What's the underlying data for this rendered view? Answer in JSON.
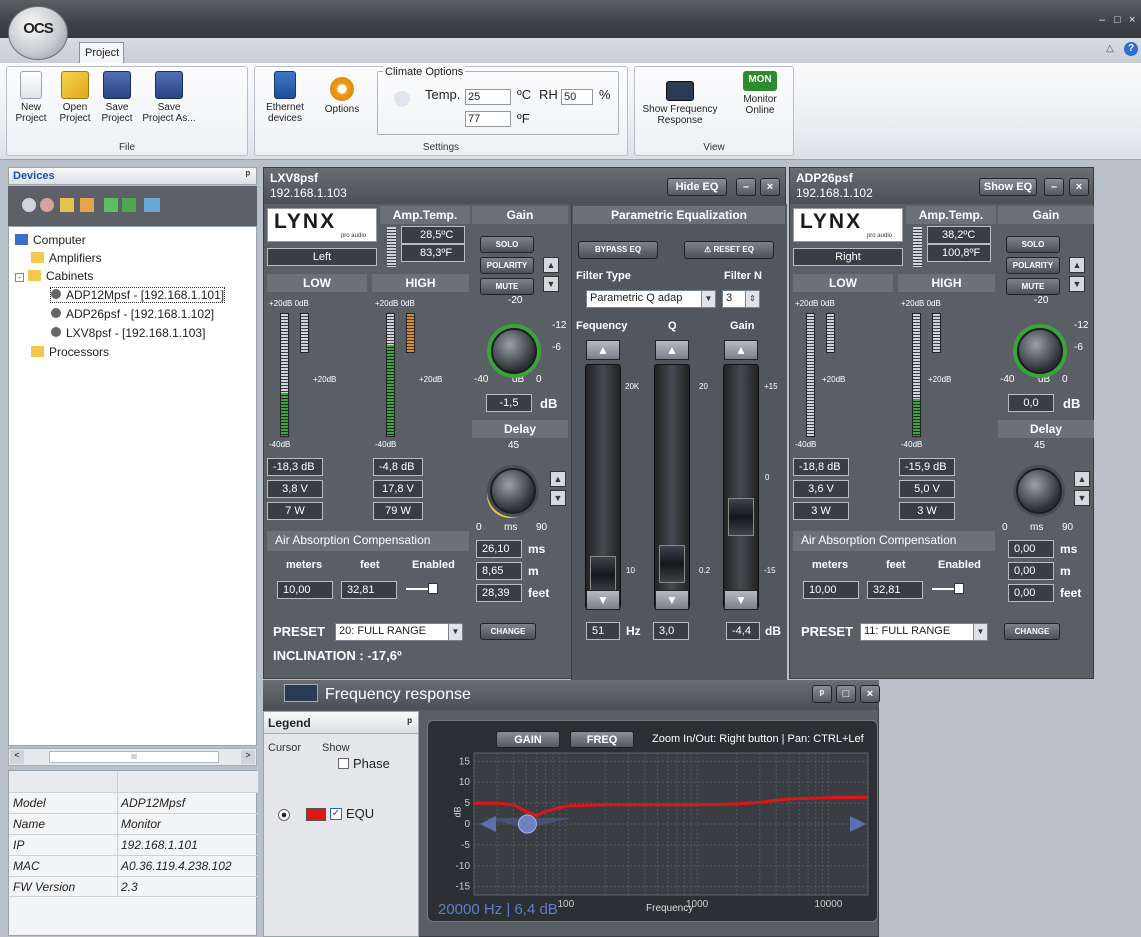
{
  "app": {
    "logo_text": "OCS",
    "tab": "Project"
  },
  "window_controls": {
    "min": "–",
    "max": "□",
    "close": "×",
    "collapse": "△",
    "help": "?"
  },
  "ribbon": {
    "file": {
      "title": "File",
      "new": "New\nProject",
      "open": "Open\nProject",
      "save": "Save\nProject",
      "save_as": "Save\nProject As..."
    },
    "settings": {
      "title": "Settings",
      "ethernet": "Ethernet\ndevices",
      "options": "Options",
      "climate_title": "Climate Options",
      "temp_label": "Temp.",
      "temp_c": "25",
      "unit_c": "ºC",
      "rh_label": "RH",
      "rh": "50",
      "unit_pct": "%",
      "temp_f": "77",
      "unit_f": "ºF"
    },
    "view": {
      "title": "View",
      "freq": "Show Frequency\nResponse",
      "monitor": "Monitor\nOnline",
      "mon_badge": "MON"
    }
  },
  "devices_panel": {
    "title": "Devices",
    "pin": "ᵖ",
    "tree": {
      "computer": "Computer",
      "amplifiers": "Amplifiers",
      "cabinets": "Cabinets",
      "cab1": "ADP12Mpsf - [192.168.1.101]",
      "cab2": "ADP26psf - [192.168.1.102]",
      "cab3": "LXV8psf - [192.168.1.103]",
      "processors": "Processors"
    },
    "scroll_mid": "III",
    "props": [
      {
        "k": "Model",
        "v": "ADP12Mpsf"
      },
      {
        "k": "Name",
        "v": "Monitor"
      },
      {
        "k": "IP",
        "v": "192.168.1.101"
      },
      {
        "k": "MAC",
        "v": "A0.36.119.4.238.102"
      },
      {
        "k": "FW Version",
        "v": "2.3"
      }
    ]
  },
  "dev1": {
    "name": "LXV8psf",
    "ip": "192.168.1.103",
    "eq_btn": "Hide EQ",
    "brand": "LYNX",
    "brand_sub": "pro audio",
    "amp_temp": "Amp.Temp.",
    "temp_c": "28,5ºC",
    "temp_f": "83,3ºF",
    "channel": "Left",
    "low": "LOW",
    "high": "HIGH",
    "gain": "Gain",
    "solo": "SOLO",
    "polarity": "POLARITY",
    "mute": "MUTE",
    "db20": "+20dB 0dB",
    "db20b": "+20dB",
    "db40": "-40dB",
    "low_db": "-18,3 dB",
    "low_v": "3,8 V",
    "low_w": "7 W",
    "high_db": "-4,8 dB",
    "high_v": "17,8 V",
    "high_w": "79 W",
    "g_m20": "-20",
    "g_m12": "-12",
    "g_m6": "-6",
    "g_m40": "-40",
    "g_0": "0",
    "g_db": "dB",
    "gain_val": "-1,5",
    "gain_unit": "dB",
    "delay": "Delay",
    "d_45": "45",
    "d_0": "0",
    "d_ms": "ms",
    "d_90": "90",
    "delay_ms": "26,10",
    "delay_m": "8,65",
    "delay_ft": "28,39",
    "u_ms": "ms",
    "u_m": "m",
    "u_ft": "feet",
    "aac": "Air Absorption Compensation",
    "meters": "meters",
    "feet": "feet",
    "enabled": "Enabled",
    "aac_m": "10,00",
    "aac_ft": "32,81",
    "preset_lbl": "PRESET",
    "preset": "20: FULL RANGE",
    "change": "CHANGE",
    "inclination": "INCLINATION : -17,6º"
  },
  "peq": {
    "title": "Parametric Equalization",
    "bypass": "BYPASS EQ",
    "reset": "⚠ RESET EQ",
    "filter_type": "Filter Type",
    "filter_n": "Filter N",
    "type": "Parametric Q adap",
    "n": "3",
    "freq": "Fequency",
    "q": "Q",
    "gain": "Gain",
    "f_20k": "20K",
    "f_10": "10",
    "q_20": "20",
    "q_02": "0.2",
    "g_15": "+15",
    "g_0": "0",
    "g_m15": "-15",
    "freq_val": "51",
    "hz": "Hz",
    "q_val": "3,0",
    "gain_val": "-4,4",
    "db": "dB",
    "fader_freq": 0.07,
    "fader_q": 0.12,
    "fader_gain": 0.35
  },
  "dev2": {
    "name": "ADP26psf",
    "ip": "192.168.1.102",
    "eq_btn": "Show EQ",
    "brand": "LYNX",
    "brand_sub": "pro audio",
    "amp_temp": "Amp.Temp.",
    "temp_c": "38,2ºC",
    "temp_f": "100,8ºF",
    "channel": "Right",
    "low": "LOW",
    "high": "HIGH",
    "gain": "Gain",
    "solo": "SOLO",
    "polarity": "POLARITY",
    "mute": "MUTE",
    "db20": "+20dB 0dB",
    "db20b": "+20dB",
    "db40": "-40dB",
    "low_db": "-18,8 dB",
    "low_v": "3,6 V",
    "low_w": "3 W",
    "high_db": "-15,9 dB",
    "high_v": "5,0 V",
    "high_w": "3 W",
    "g_m20": "-20",
    "g_m12": "-12",
    "g_m6": "-6",
    "g_m40": "-40",
    "g_0": "0",
    "g_db": "dB",
    "gain_val": "0,0",
    "gain_unit": "dB",
    "delay": "Delay",
    "d_45": "45",
    "d_0": "0",
    "d_ms": "ms",
    "d_90": "90",
    "delay_ms": "0,00",
    "delay_m": "0,00",
    "delay_ft": "0,00",
    "u_ms": "ms",
    "u_m": "m",
    "u_ft": "feet",
    "aac": "Air Absorption Compensation",
    "meters": "meters",
    "feet": "feet",
    "enabled": "Enabled",
    "aac_m": "10,00",
    "aac_ft": "32,81",
    "preset_lbl": "PRESET",
    "preset": "11: FULL RANGE",
    "change": "CHANGE"
  },
  "freq_resp": {
    "title": "Frequency response",
    "legend": "Legend",
    "cursor": "Cursor",
    "show": "Show",
    "phase": "Phase",
    "equ": "EQU",
    "gain_btn": "GAIN",
    "freq_btn": "FREQ",
    "hint": "Zoom In/Out: Right button | Pan: CTRL+Lef",
    "readout": "20000 Hz | 6,4 dB",
    "xlabel": "Frequency",
    "ylabel": "dB",
    "colors": {
      "curve": "#e01515",
      "marker": "#4a5a80"
    }
  },
  "chart_data": {
    "type": "line",
    "xlabel": "Frequency",
    "ylabel": "dB",
    "xscale": "log",
    "xlim": [
      20,
      20000
    ],
    "ylim": [
      -17,
      17
    ],
    "x_ticks": [
      "100",
      "1000",
      "10000"
    ],
    "y_ticks": [
      "15",
      "10",
      "5",
      "0",
      "-5",
      "-10",
      "-15"
    ],
    "series": [
      {
        "name": "EQU",
        "x": [
          20,
          30,
          40,
          50,
          60,
          70,
          100,
          200,
          500,
          1000,
          1500,
          2000,
          3000,
          5000,
          10000,
          20000
        ],
        "y": [
          5.0,
          5.0,
          4.6,
          3.0,
          2.0,
          3.0,
          4.3,
          4.6,
          4.6,
          4.6,
          4.7,
          4.8,
          5.2,
          6.0,
          6.3,
          6.4
        ]
      }
    ]
  }
}
